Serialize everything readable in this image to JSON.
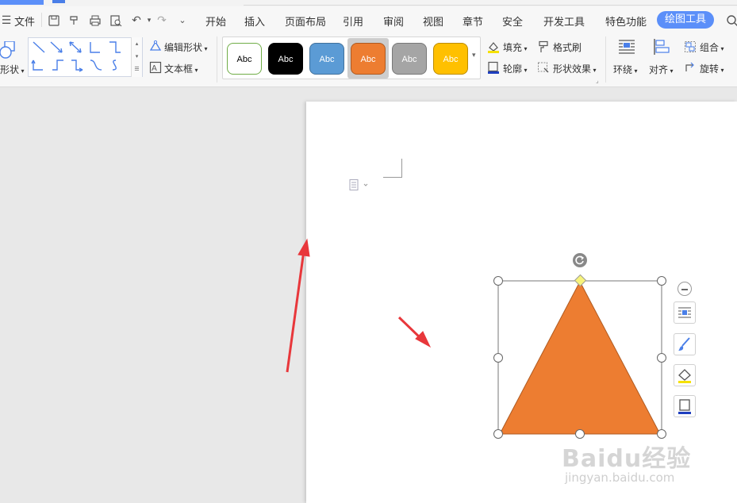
{
  "menu": {
    "file_label": "文件",
    "tabs": [
      "开始",
      "插入",
      "页面布局",
      "引用",
      "审阅",
      "视图",
      "章节",
      "安全",
      "开发工具",
      "特色功能"
    ],
    "active_tab": "绘图工具"
  },
  "ribbon": {
    "shape_label": "形状",
    "edit_shape_label": "编辑形状",
    "textbox_label": "文本框",
    "style_buttons": [
      {
        "label": "Abc",
        "bg": "#ffffff",
        "fg": "#000000",
        "border": "#70ad47"
      },
      {
        "label": "Abc",
        "bg": "#000000",
        "fg": "#ffffff",
        "border": "#000000"
      },
      {
        "label": "Abc",
        "bg": "#5b9bd5",
        "fg": "#ffffff",
        "border": "#41719c"
      },
      {
        "label": "Abc",
        "bg": "#ed7d31",
        "fg": "#ffffff",
        "border": "#ae5a21"
      },
      {
        "label": "Abc",
        "bg": "#a5a5a5",
        "fg": "#ffffff",
        "border": "#787878"
      },
      {
        "label": "Abc",
        "bg": "#ffc000",
        "fg": "#ffffff",
        "border": "#bc8c00"
      }
    ],
    "fill_label": "填充",
    "format_painter_label": "格式刷",
    "outline_label": "轮廓",
    "shape_effect_label": "形状效果",
    "wrap_label": "环绕",
    "align_label": "对齐",
    "group_label": "组合",
    "rotate_label": "旋转"
  },
  "document": {
    "shape_fill": "#ed7d31",
    "shape_stroke": "#ae5a21",
    "arrow_color": "#e8373b"
  },
  "watermark": {
    "brand": "Baidu经验",
    "url": "jingyan.baidu.com"
  }
}
